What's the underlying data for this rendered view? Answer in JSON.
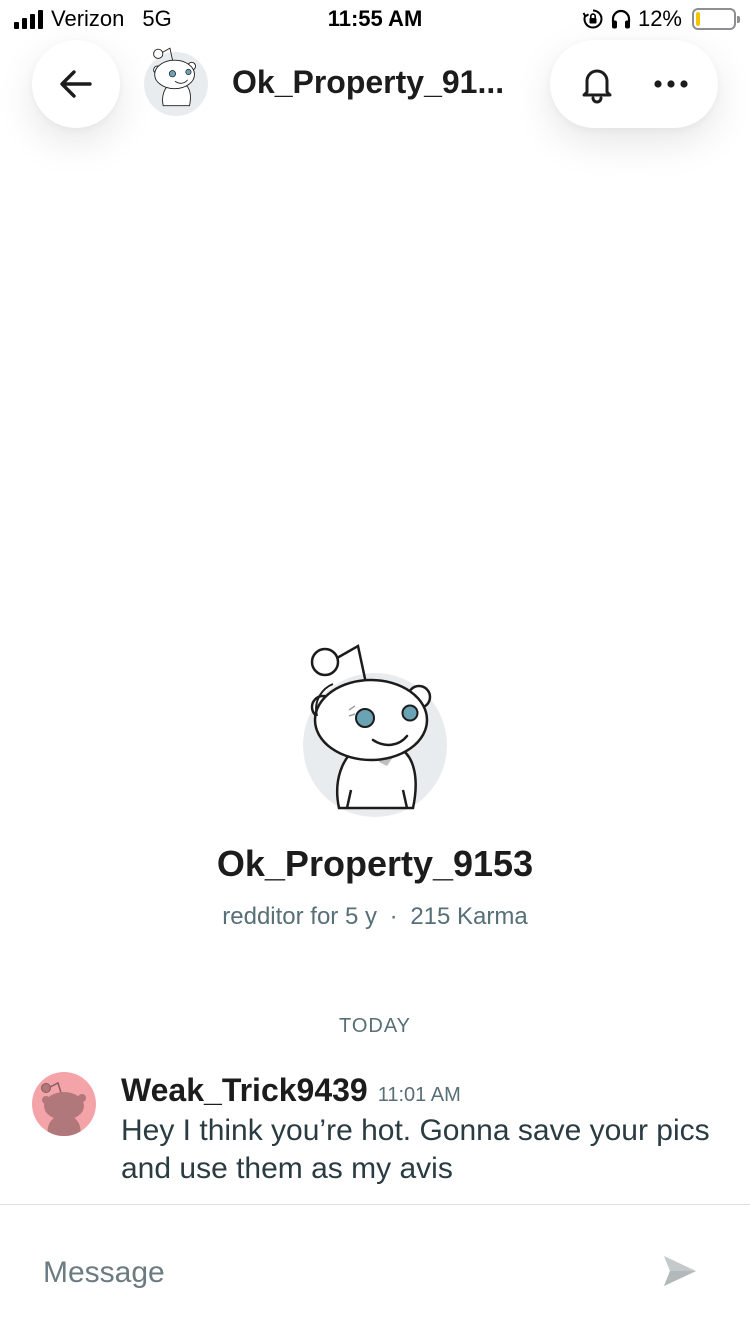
{
  "status_bar": {
    "carrier": "Verizon",
    "network": "5G",
    "time": "11:55 AM",
    "battery_percent_label": "12%",
    "battery_level": 0.12,
    "battery_color": "#f5c400",
    "icons": [
      "signal-icon",
      "orientation-lock-icon",
      "headphones-icon",
      "battery-icon"
    ]
  },
  "header": {
    "title": "Ok_Property_91...",
    "back_icon": "arrow-left-icon",
    "actions": [
      "bell-icon",
      "more-horizontal-icon"
    ]
  },
  "profile": {
    "username": "Ok_Property_9153",
    "tenure": "redditor for 5 y",
    "separator": "·",
    "karma": "215 Karma"
  },
  "chat": {
    "day_label": "TODAY",
    "messages": [
      {
        "author": "Weak_Trick9439",
        "time": "11:01 AM",
        "text": "Hey I think you’re hot. Gonna save your pics and use them as my avis",
        "avatar_color": "#f4a3a8"
      }
    ]
  },
  "composer": {
    "placeholder": "Message",
    "send_icon": "send-icon"
  },
  "colors": {
    "text_primary": "#1c1c1c",
    "text_secondary": "#576f76",
    "avatar_bg": "#e9ecef",
    "snoo_eye": "#6aa3b4"
  }
}
